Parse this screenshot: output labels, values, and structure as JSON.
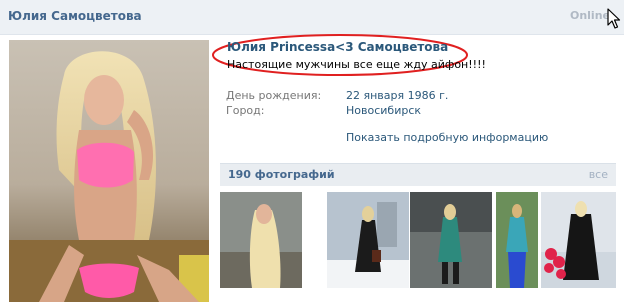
{
  "topbar": {
    "name": "Юлия Самоцветова",
    "status": "Online"
  },
  "profile": {
    "name": "Юлия Princessa<3 Самоцветова",
    "status": "Настоящие мужчины все еще жду айфон!!!!"
  },
  "info": {
    "birthday_label": "День рождения:",
    "birthday_value": "22 января 1986 г.",
    "city_label": "Город:",
    "city_value": "Новосибирск",
    "more_link": "Показать подробную информацию"
  },
  "photos": {
    "title": "190 фотографий",
    "all_link": "все",
    "thumbs": [
      "photo-1",
      "photo-2",
      "photo-3",
      "photo-4",
      "photo-5"
    ]
  },
  "colors": {
    "link": "#2b587a",
    "header_bg": "#edf1f5",
    "highlight_oval": "#e02020"
  }
}
